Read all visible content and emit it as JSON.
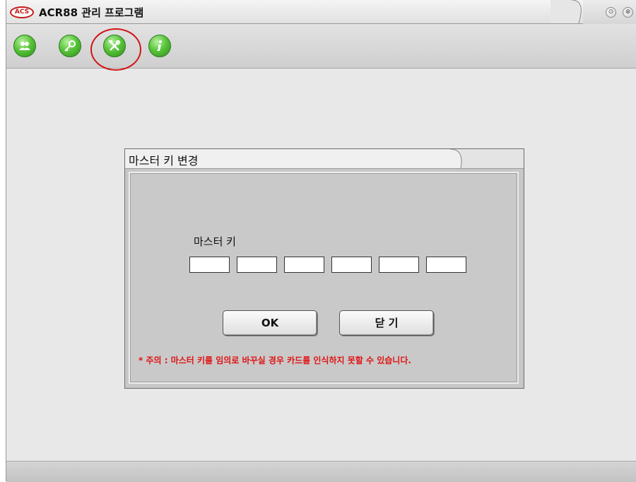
{
  "app": {
    "logo_text": "ACS",
    "title": "ACR88 관리 프로그램",
    "minimize_symbol": "⊙",
    "close_symbol": "⊗"
  },
  "toolbar": {
    "buttons": [
      {
        "name": "users",
        "icon": "users-icon"
      },
      {
        "name": "key",
        "icon": "key-icon"
      },
      {
        "name": "tools",
        "icon": "tools-icon",
        "selected": true
      },
      {
        "name": "info",
        "icon": "info-icon"
      }
    ],
    "highlight_color": "#d11414"
  },
  "dialog": {
    "title": "마스터 키 변경",
    "field_label": "마스터 키",
    "key_fields": [
      "",
      "",
      "",
      "",
      "",
      ""
    ],
    "ok_label": "OK",
    "close_label": "닫 기",
    "warning": "* 주의 : 마스터 키를 임의로 바꾸실 경우 카드를 인식하지 못할 수  있습니다.",
    "warning_color": "#e01414"
  }
}
